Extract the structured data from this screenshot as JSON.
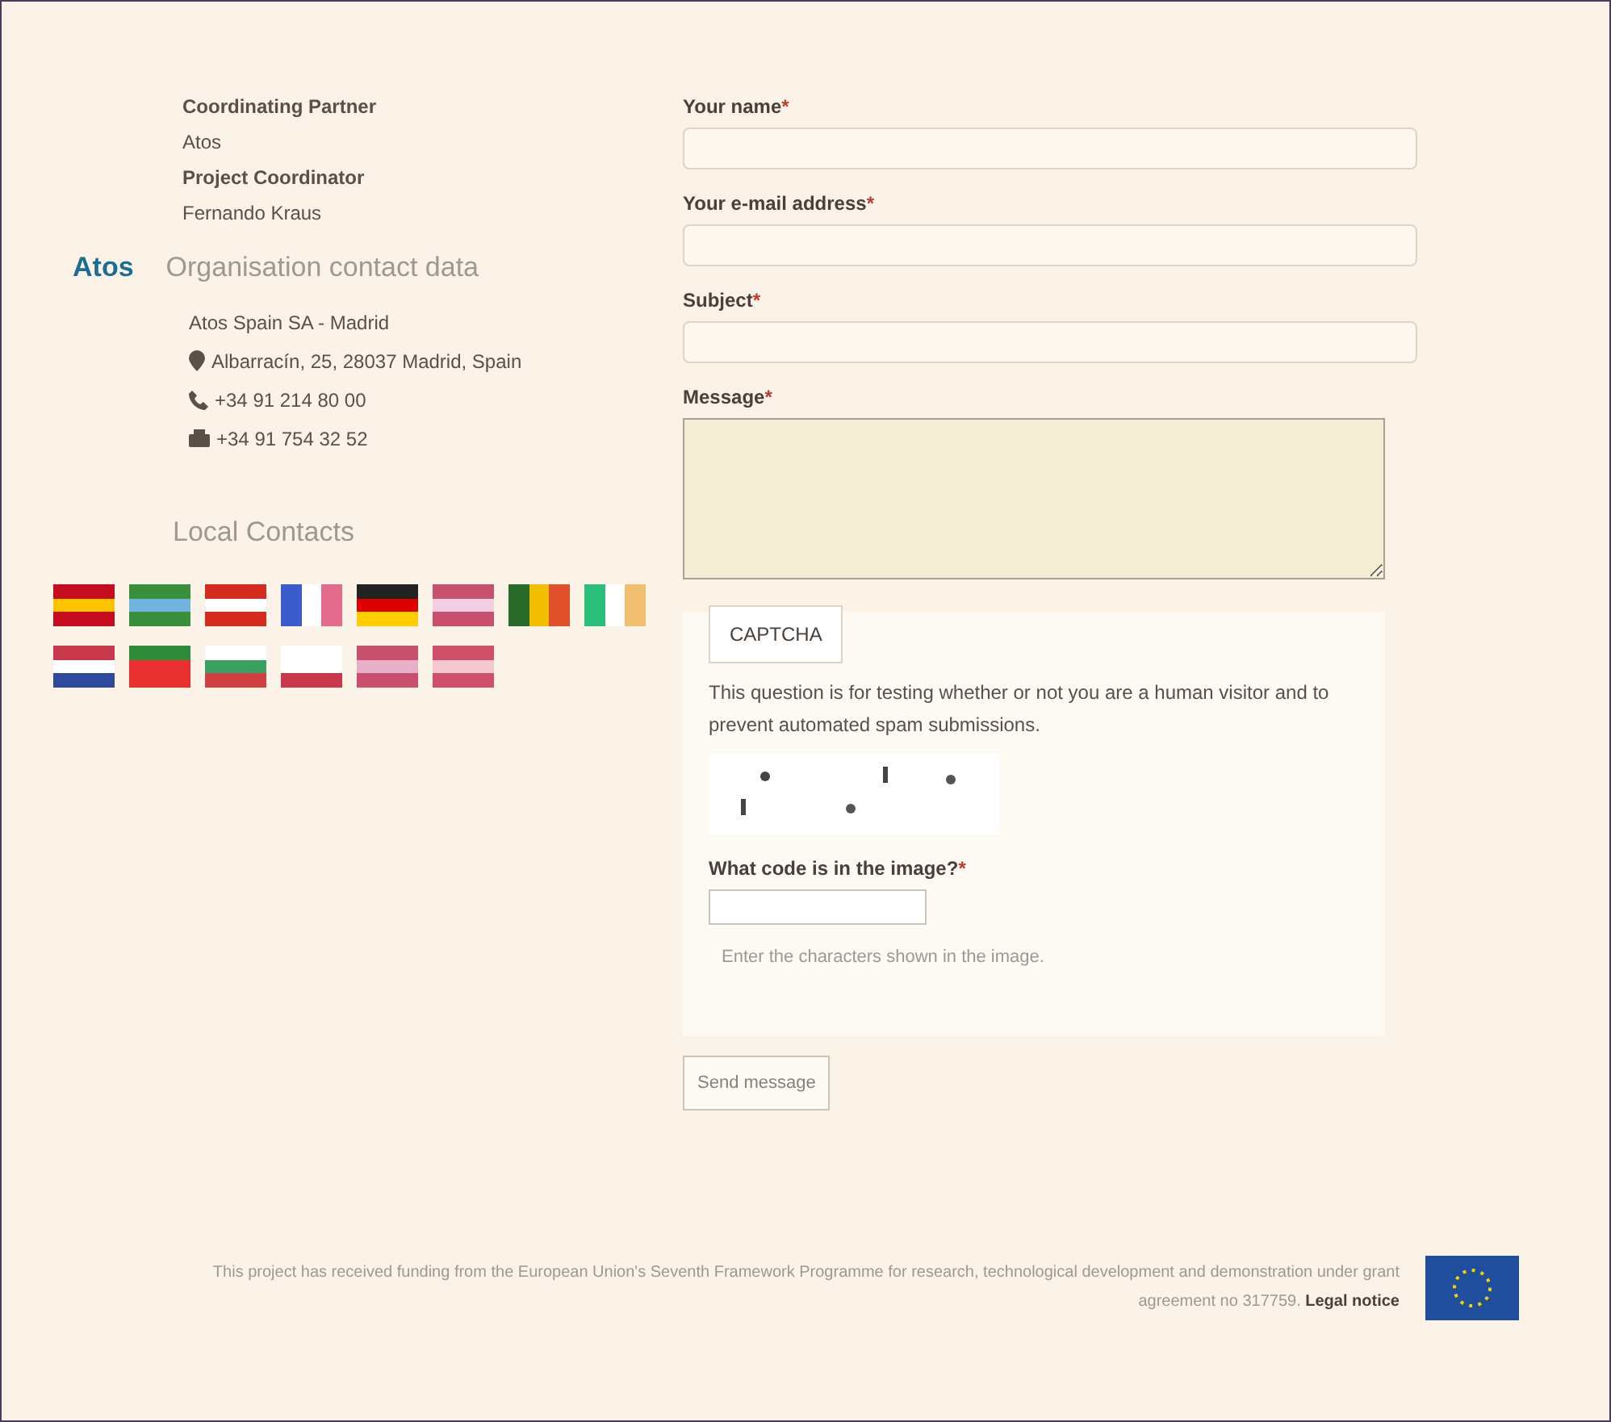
{
  "partner": {
    "coordinating_label": "Coordinating Partner",
    "coordinating_value": "Atos",
    "coordinator_label": "Project Coordinator",
    "coordinator_value": "Fernando Kraus"
  },
  "organisation": {
    "logo": "Atos",
    "title": "Organisation contact data",
    "name": "Atos Spain SA - Madrid",
    "address": "Albarracín, 25, 28037 Madrid, Spain",
    "phone": "+34 91 214 80 00",
    "fax": "+34 91 754 32 52"
  },
  "local_contacts": {
    "title": "Local Contacts"
  },
  "form": {
    "fields": [
      {
        "label": "Your name",
        "required": "*",
        "kind": "input"
      },
      {
        "label": "Your e-mail address",
        "required": "*",
        "kind": "input"
      },
      {
        "label": "Subject",
        "required": "*",
        "kind": "input"
      },
      {
        "label": "Message",
        "required": "*",
        "kind": "textarea"
      }
    ],
    "captcha": {
      "legend": "CAPTCHA",
      "description": "This question is for testing whether or not you are a human visitor and to prevent automated spam submissions.",
      "code_label": "What code is in the image?",
      "required": "*",
      "hint": "Enter the characters shown in the image."
    },
    "submit": "Send message"
  },
  "footer": {
    "text": "This project has received funding from the European Union's Seventh Framework Programme for research, technological development and demonstration under grant agreement no 317759.",
    "link": "Legal notice"
  }
}
